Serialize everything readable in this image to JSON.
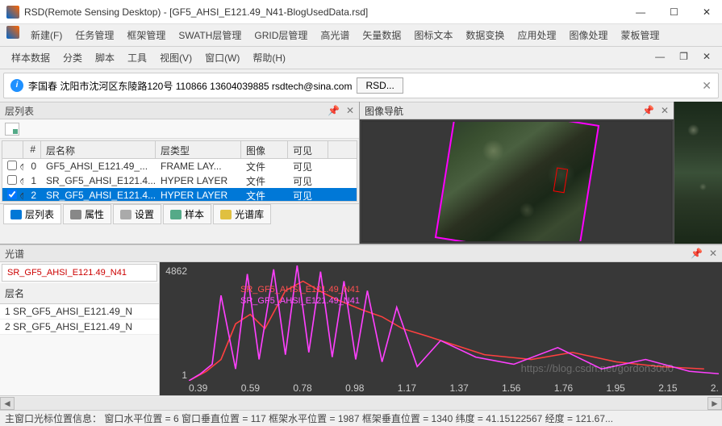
{
  "window": {
    "title": "RSD(Remote Sensing Desktop) - [GF5_AHSI_E121.49_N41-BlogUsedData.rsd]"
  },
  "menu1": [
    "新建(F)",
    "任务管理",
    "框架管理",
    "SWATH层管理",
    "GRID层管理",
    "高光谱",
    "矢量数据",
    "图标文本",
    "数据变换",
    "应用处理",
    "图像处理",
    "蒙板管理"
  ],
  "menu2": [
    "样本数据",
    "分类",
    "脚本",
    "工具",
    "视图(V)",
    "窗口(W)",
    "帮助(H)"
  ],
  "info": {
    "text": "李国春 沈阳市沈河区东陵路120号 110866 13604039885 rsdtech@sina.com",
    "button": "RSD..."
  },
  "layerpane": {
    "title": "层列表",
    "headers": {
      "idx": "#",
      "name": "层名称",
      "type": "层类型",
      "img": "图像",
      "vis": "可见"
    },
    "rows": [
      {
        "checked": false,
        "eye": true,
        "idx": 0,
        "name": "GF5_AHSI_E121.49_...",
        "type": "FRAME LAY...",
        "img": "文件",
        "vis": "可见",
        "sel": false
      },
      {
        "checked": false,
        "eye": true,
        "idx": 1,
        "name": "SR_GF5_AHSI_E121.4...",
        "type": "HYPER LAYER",
        "img": "文件",
        "vis": "可见",
        "sel": false
      },
      {
        "checked": true,
        "eye": true,
        "idx": 2,
        "name": "SR_GF5_AHSI_E121.4...",
        "type": "HYPER LAYER",
        "img": "文件",
        "vis": "可见",
        "sel": true
      }
    ]
  },
  "tabs": [
    {
      "label": "层列表",
      "active": true,
      "icon": "list"
    },
    {
      "label": "属性",
      "active": false,
      "icon": "prop"
    },
    {
      "label": "设置",
      "active": false,
      "icon": "set"
    },
    {
      "label": "样本",
      "active": false,
      "icon": "samp"
    },
    {
      "label": "光谱库",
      "active": false,
      "icon": "spec"
    }
  ],
  "navpane": {
    "title": "图像导航"
  },
  "specpane": {
    "title": "光谱",
    "selected": "SR_GF5_AHSI_E121.49_N41",
    "layerlabel": "层名",
    "rows": [
      "1 SR_GF5_AHSI_E121.49_N",
      "2 SR_GF5_AHSI_E121.49_N"
    ],
    "legend1": "SR_GF5_AHSI_E121.49_N41",
    "legend2": "SR_GF5_AHSI_E121.49_N41"
  },
  "chart_data": {
    "type": "line",
    "xlabel": "",
    "ylabel": "",
    "xlim": [
      0.39,
      2.2
    ],
    "ylim": [
      1,
      4862
    ],
    "xticks": [
      0.39,
      0.59,
      0.78,
      0.98,
      1.17,
      1.37,
      1.56,
      1.76,
      1.95,
      2.15,
      "2."
    ],
    "yticks": [
      1,
      4862
    ],
    "series": [
      {
        "name": "SR_GF5_AHSI_E121.49_N41",
        "color": "#ff4040",
        "x": [
          0.39,
          0.45,
          0.5,
          0.55,
          0.6,
          0.65,
          0.72,
          0.78,
          0.85,
          0.9,
          0.98,
          1.05,
          1.12,
          1.2,
          1.3,
          1.4,
          1.56,
          1.7,
          1.85,
          2.0,
          2.15
        ],
        "y": [
          1,
          400,
          900,
          2400,
          2800,
          2200,
          3800,
          4200,
          3700,
          3400,
          3000,
          2700,
          2200,
          1900,
          1500,
          1100,
          900,
          1200,
          800,
          600,
          500
        ]
      },
      {
        "name": "SR_GF5_AHSI_E121.49_N41",
        "color": "#ff40ff",
        "x": [
          0.39,
          0.43,
          0.47,
          0.5,
          0.55,
          0.59,
          0.63,
          0.68,
          0.72,
          0.76,
          0.8,
          0.84,
          0.88,
          0.92,
          0.96,
          1.0,
          1.05,
          1.1,
          1.17,
          1.25,
          1.37,
          1.5,
          1.65,
          1.8,
          1.95,
          2.1,
          2.2
        ],
        "y": [
          1,
          300,
          700,
          3600,
          500,
          4500,
          900,
          4700,
          1100,
          4862,
          1200,
          4600,
          1000,
          4200,
          900,
          3800,
          800,
          3100,
          600,
          1700,
          1000,
          700,
          1400,
          500,
          900,
          400,
          300
        ]
      }
    ]
  },
  "statusbar": "主窗口光标位置信息：  窗口水平位置 = 6 窗口垂直位置 = 117 框架水平位置 = 1987 框架垂直位置 = 1340 纬度 =  41.15122567 经度 =  121.67...",
  "watermark": "https://blog.csdn.net/gordon3000"
}
